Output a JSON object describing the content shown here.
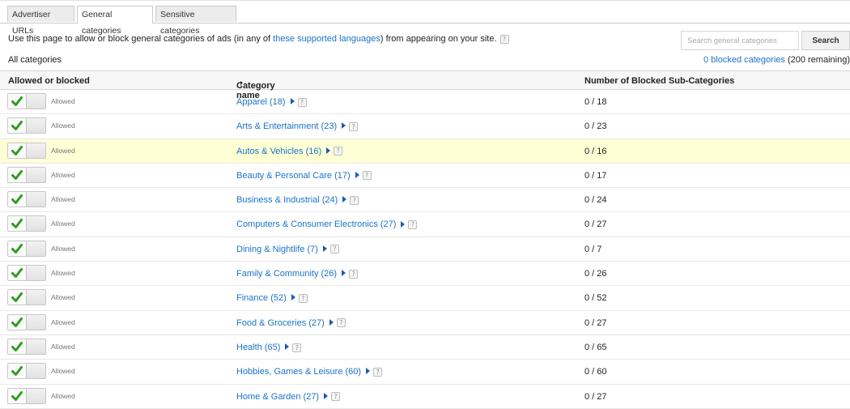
{
  "tabs": [
    {
      "label": "Advertiser URLs",
      "active": false
    },
    {
      "label": "General categories",
      "active": true
    },
    {
      "label": "Sensitive categories",
      "active": false
    }
  ],
  "description": {
    "before": "Use this page to allow or block general categories of ads (in any of ",
    "link": "these supported languages",
    "after": ") from appearing on your site."
  },
  "help_glyph": "?",
  "search": {
    "placeholder": "Search general categories",
    "button": "Search"
  },
  "all_categories_label": "All categories",
  "blocked_summary": {
    "link": "0 blocked categories",
    "rest": "(200 remaining)"
  },
  "table": {
    "headers": {
      "allowed": "Allowed or blocked",
      "category": "Category name",
      "sort_indicator": "↑",
      "count": "Number of Blocked Sub-Categories"
    },
    "rows": [
      {
        "status": "Allowed",
        "name": "Apparel (18)",
        "count": "0 / 18"
      },
      {
        "status": "Allowed",
        "name": "Arts & Entertainment (23)",
        "count": "0 / 23"
      },
      {
        "status": "Allowed",
        "name": "Autos & Vehicles (16)",
        "count": "0 / 16",
        "highlighted": true
      },
      {
        "status": "Allowed",
        "name": "Beauty & Personal Care (17)",
        "count": "0 / 17"
      },
      {
        "status": "Allowed",
        "name": "Business & Industrial (24)",
        "count": "0 / 24"
      },
      {
        "status": "Allowed",
        "name": "Computers & Consumer Electronics (27)",
        "count": "0 / 27"
      },
      {
        "status": "Allowed",
        "name": "Dining & Nightlife (7)",
        "count": "0 / 7"
      },
      {
        "status": "Allowed",
        "name": "Family & Community (26)",
        "count": "0 / 26"
      },
      {
        "status": "Allowed",
        "name": "Finance (52)",
        "count": "0 / 52"
      },
      {
        "status": "Allowed",
        "name": "Food & Groceries (27)",
        "count": "0 / 27"
      },
      {
        "status": "Allowed",
        "name": "Health (65)",
        "count": "0 / 65"
      },
      {
        "status": "Allowed",
        "name": "Hobbies, Games & Leisure (60)",
        "count": "0 / 60"
      },
      {
        "status": "Allowed",
        "name": "Home & Garden (27)",
        "count": "0 / 27"
      }
    ]
  },
  "colors": {
    "link": "#1a73c8",
    "check": "#2e9b1f",
    "highlight_row": "#ffffd6"
  }
}
